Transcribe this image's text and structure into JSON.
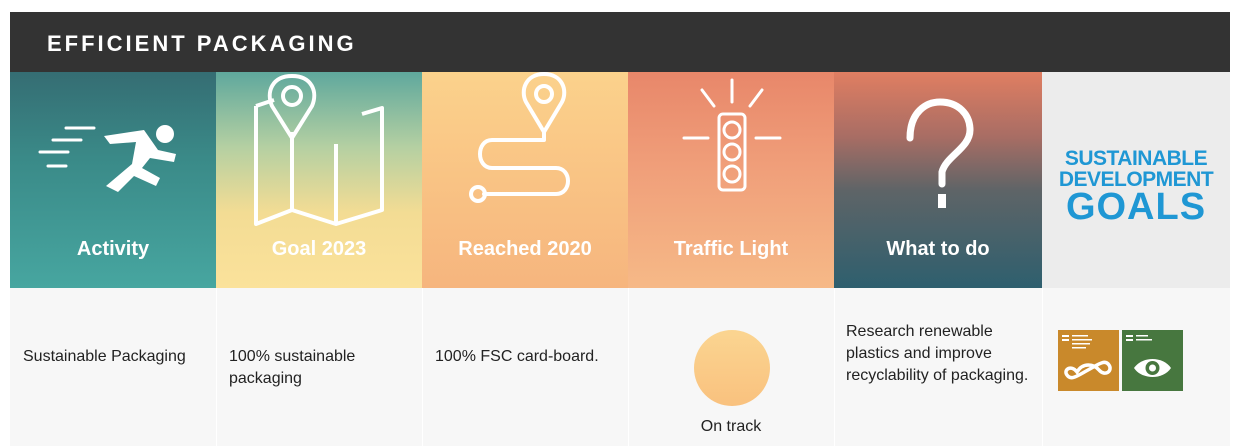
{
  "title": "EFFICIENT PACKAGING",
  "columns": [
    {
      "label": "Activity",
      "icon": "running-person-icon"
    },
    {
      "label": "Goal 2023",
      "icon": "map-pin-icon"
    },
    {
      "label": "Reached 2020",
      "icon": "route-icon"
    },
    {
      "label": "Traffic Light",
      "icon": "traffic-light-icon"
    },
    {
      "label": "What to do",
      "icon": "question-mark-icon"
    }
  ],
  "sdg_logo": {
    "line1": "SUSTAINABLE",
    "line2": "DEVELOPMENT",
    "line3": "GOALS",
    "color": "#1f97d4"
  },
  "row": {
    "activity": "Sustainable Packaging",
    "goal_2023": "100% sustainable packaging",
    "reached_2020": "100% FSC card-board.",
    "traffic_light": {
      "status": "On track",
      "color": "#f9c27f"
    },
    "what_to_do": "Research renewable plastics and improve recyclability of packaging.",
    "sdg_icons": [
      {
        "name": "sdg-12-icon",
        "color": "#c9892b",
        "number": "12"
      },
      {
        "name": "sdg-13-icon",
        "color": "#47773f",
        "number": "13"
      }
    ]
  }
}
